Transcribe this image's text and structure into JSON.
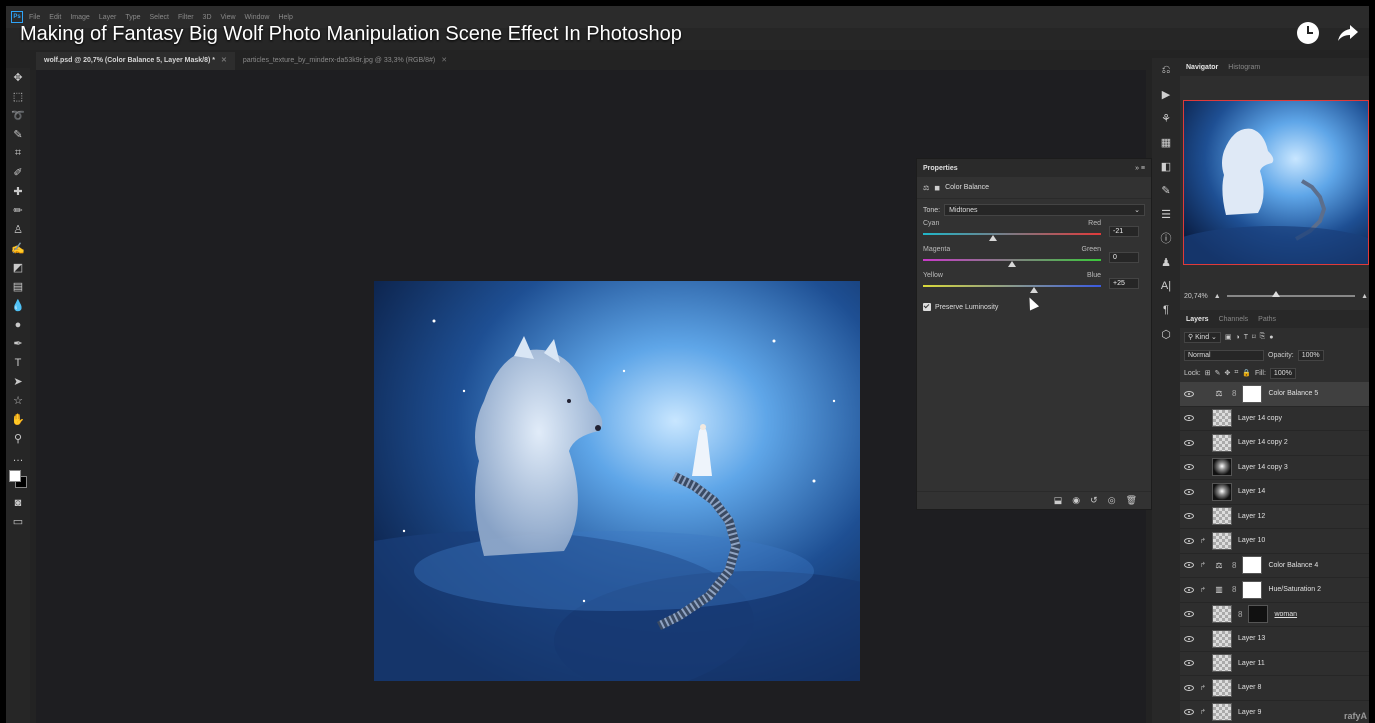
{
  "video": {
    "title": "Making of Fantasy Big Wolf Photo Manipulation Scene Effect In Photoshop"
  },
  "menu": [
    "File",
    "Edit",
    "Image",
    "Layer",
    "Type",
    "Select",
    "Filter",
    "3D",
    "View",
    "Window",
    "Help"
  ],
  "logo": "Ps",
  "doc_tabs": [
    {
      "label": "wolf.psd @ 20,7% (Color Balance 5, Layer Mask/8) *",
      "active": true
    },
    {
      "label": "particles_texture_by_minderx-da53k9r.jpg @ 33,3% (RGB/8#)",
      "active": false
    }
  ],
  "tools": [
    "move",
    "marquee",
    "lasso",
    "quick-select",
    "crop",
    "eyedropper",
    "healing",
    "brush",
    "stamp",
    "history-brush",
    "eraser",
    "gradient",
    "blur",
    "dodge",
    "pen",
    "type",
    "path-select",
    "shape",
    "hand",
    "zoom",
    "more"
  ],
  "properties": {
    "title": "Properties",
    "subtitle": "Color Balance",
    "tone_label": "Tone:",
    "tone_value": "Midtones",
    "sliders": [
      {
        "left": "Cyan",
        "right": "Red",
        "value": "-21",
        "level": -21,
        "track": "linear-gradient(90deg,#1fb6c9,#e03a3a)"
      },
      {
        "left": "Magenta",
        "right": "Green",
        "value": "0",
        "level": 0,
        "track": "linear-gradient(90deg,#c93ac9,#3ac93a)"
      },
      {
        "left": "Yellow",
        "right": "Blue",
        "value": "+25",
        "level": 25,
        "track": "linear-gradient(90deg,#d9d93a,#3a5ae0)"
      }
    ],
    "preserve_luminosity": "Preserve Luminosity"
  },
  "navigator": {
    "tabs": [
      "Navigator",
      "Histogram"
    ],
    "zoom": "20,74%"
  },
  "layers_panel": {
    "tabs": [
      "Layers",
      "Channels",
      "Paths"
    ],
    "filter": "Kind",
    "blend_mode": "Normal",
    "opacity_label": "Opacity:",
    "opacity": "100%",
    "lock_label": "Lock:",
    "fill_label": "Fill:",
    "fill": "100%",
    "layers": [
      {
        "name": "Color Balance 5",
        "selected": true,
        "kind": "adjust-balance"
      },
      {
        "name": "Layer 14 copy",
        "kind": "checker"
      },
      {
        "name": "Layer 14 copy 2",
        "kind": "checker"
      },
      {
        "name": "Layer 14 copy 3",
        "kind": "mask"
      },
      {
        "name": "Layer 14",
        "kind": "mask"
      },
      {
        "name": "Layer 12",
        "kind": "checker"
      },
      {
        "name": "Layer 10",
        "kind": "checker",
        "clipped": true
      },
      {
        "name": "Color Balance 4",
        "kind": "adjust-balance",
        "clipped": true
      },
      {
        "name": "Hue/Saturation 2",
        "kind": "adjust-hue",
        "clipped": true
      },
      {
        "name": "woman",
        "kind": "masked"
      },
      {
        "name": "Layer 13",
        "kind": "checker"
      },
      {
        "name": "Layer 11",
        "kind": "checker"
      },
      {
        "name": "Layer 8",
        "kind": "checker",
        "clipped": true
      },
      {
        "name": "Layer 9",
        "kind": "checker",
        "clipped": true
      }
    ]
  },
  "watermark": "rafyA"
}
